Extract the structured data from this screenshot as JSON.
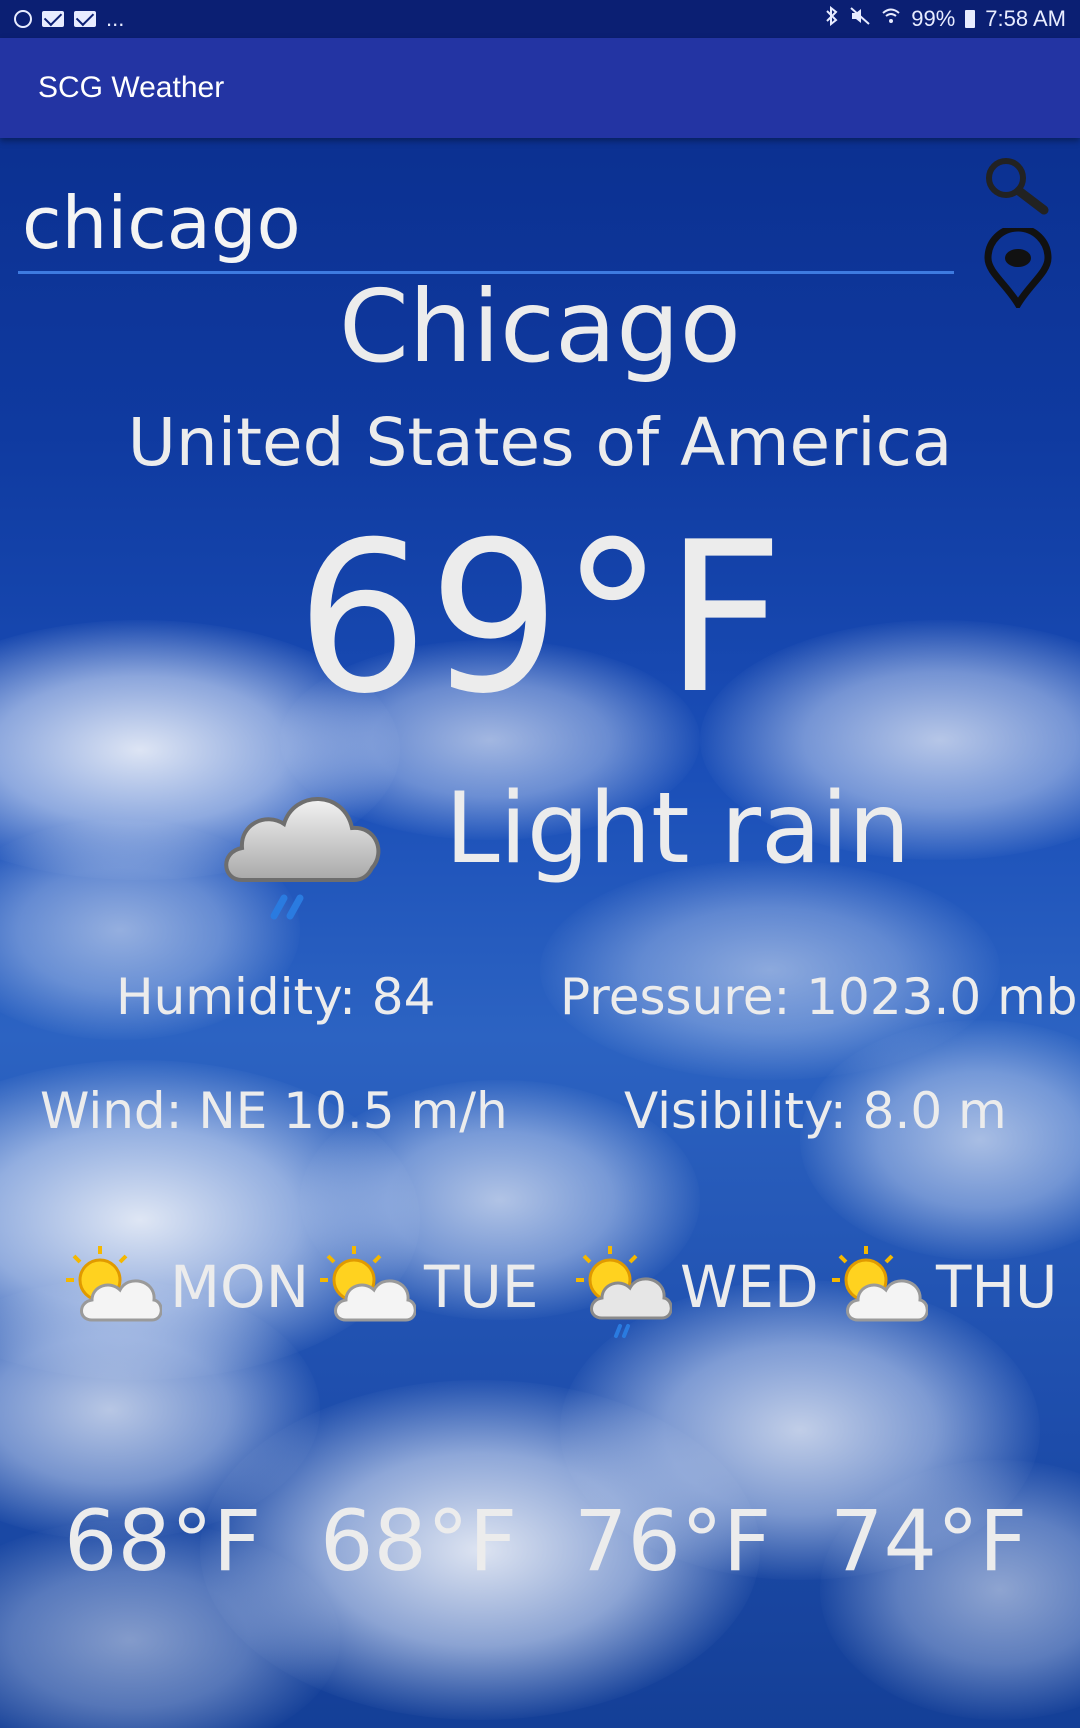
{
  "status_bar": {
    "notification_overflow": "...",
    "battery": "99%",
    "time": "7:58 AM",
    "icons_left": [
      "alarm-icon",
      "mail-icon",
      "mail-icon"
    ],
    "icons_right": [
      "bluetooth-icon",
      "mute-icon",
      "wifi-icon",
      "battery-icon"
    ]
  },
  "app_bar": {
    "title": "SCG Weather"
  },
  "search": {
    "value": "chicago",
    "search_icon": "search-icon",
    "location_icon": "location-pin-icon"
  },
  "current": {
    "city": "Chicago",
    "country": "United States of America",
    "temperature": "69°F",
    "condition": "Light rain",
    "condition_icon": "rain-cloud-icon",
    "humidity": "Humidity: 84",
    "pressure": "Pressure: 1023.0 mb",
    "wind": "Wind: NE 10.5 m/h",
    "visibility": "Visibility: 8.0 m"
  },
  "forecast": [
    {
      "day": "MON",
      "temp": "68°F",
      "icon": "partly-cloudy-icon"
    },
    {
      "day": "TUE",
      "temp": "68°F",
      "icon": "partly-cloudy-icon"
    },
    {
      "day": "WED",
      "temp": "76°F",
      "icon": "partly-cloudy-rain-icon"
    },
    {
      "day": "THU",
      "temp": "74°F",
      "icon": "partly-cloudy-icon"
    }
  ],
  "colors": {
    "status_bar": "#0b1f73",
    "app_bar": "#2334a3",
    "underline": "#3e7be0",
    "text": "#ececec"
  }
}
